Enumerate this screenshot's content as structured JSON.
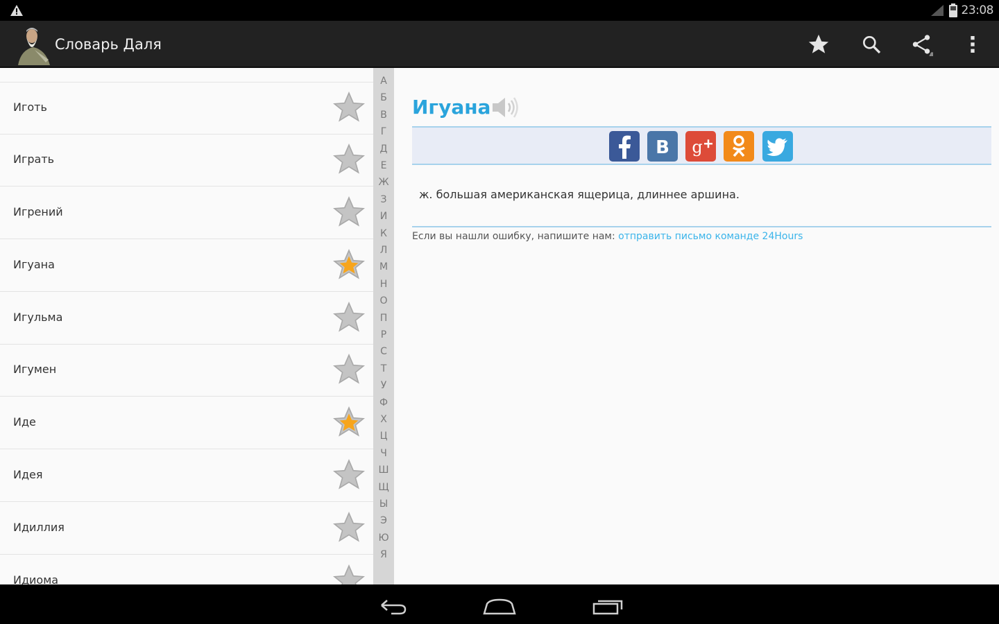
{
  "status_bar": {
    "time": "23:08",
    "warning_icon": "warning-icon",
    "signal_icon": "signal-icon",
    "battery_icon": "battery-icon"
  },
  "action_bar": {
    "title": "Словарь Даля",
    "logo_icon": "dal-portrait-icon",
    "actions": [
      "favorites-star-icon",
      "search-icon",
      "share-icon",
      "overflow-menu-icon"
    ]
  },
  "word_list": [
    {
      "word": "Иготь",
      "favorite": false
    },
    {
      "word": "Играть",
      "favorite": false
    },
    {
      "word": "Игрений",
      "favorite": false
    },
    {
      "word": "Игуана",
      "favorite": true
    },
    {
      "word": "Игульма",
      "favorite": false
    },
    {
      "word": "Игумен",
      "favorite": false
    },
    {
      "word": "Иде",
      "favorite": true
    },
    {
      "word": "Идея",
      "favorite": false
    },
    {
      "word": "Идиллия",
      "favorite": false
    },
    {
      "word": "Идиома",
      "favorite": false
    }
  ],
  "alphabet": [
    "А",
    "Б",
    "В",
    "Г",
    "Д",
    "Е",
    "Ж",
    "З",
    "И",
    "К",
    "Л",
    "М",
    "Н",
    "О",
    "П",
    "Р",
    "С",
    "Т",
    "У",
    "Ф",
    "Х",
    "Ц",
    "Ч",
    "Ш",
    "Щ",
    "Ы",
    "Э",
    "Ю",
    "Я"
  ],
  "detail": {
    "title": "Игуана",
    "speaker_icon": "speaker-icon",
    "share_icons": [
      "facebook-icon",
      "vk-icon",
      "google-plus-icon",
      "odnoklassniki-icon",
      "twitter-icon"
    ],
    "definition": "ж. большая американская ящерица, длиннее аршина.",
    "report_text": "Если вы нашли ошибку, напишите нам: ",
    "report_link": "отправить письмо команде 24Hours"
  },
  "nav_bar": {
    "buttons": [
      "back-icon",
      "home-icon",
      "recents-icon"
    ]
  },
  "colors": {
    "accent": "#2aa4dc",
    "star_favorite": "#f7a51c",
    "star_default": "#c4c4c4",
    "action_bar": "#222222"
  }
}
